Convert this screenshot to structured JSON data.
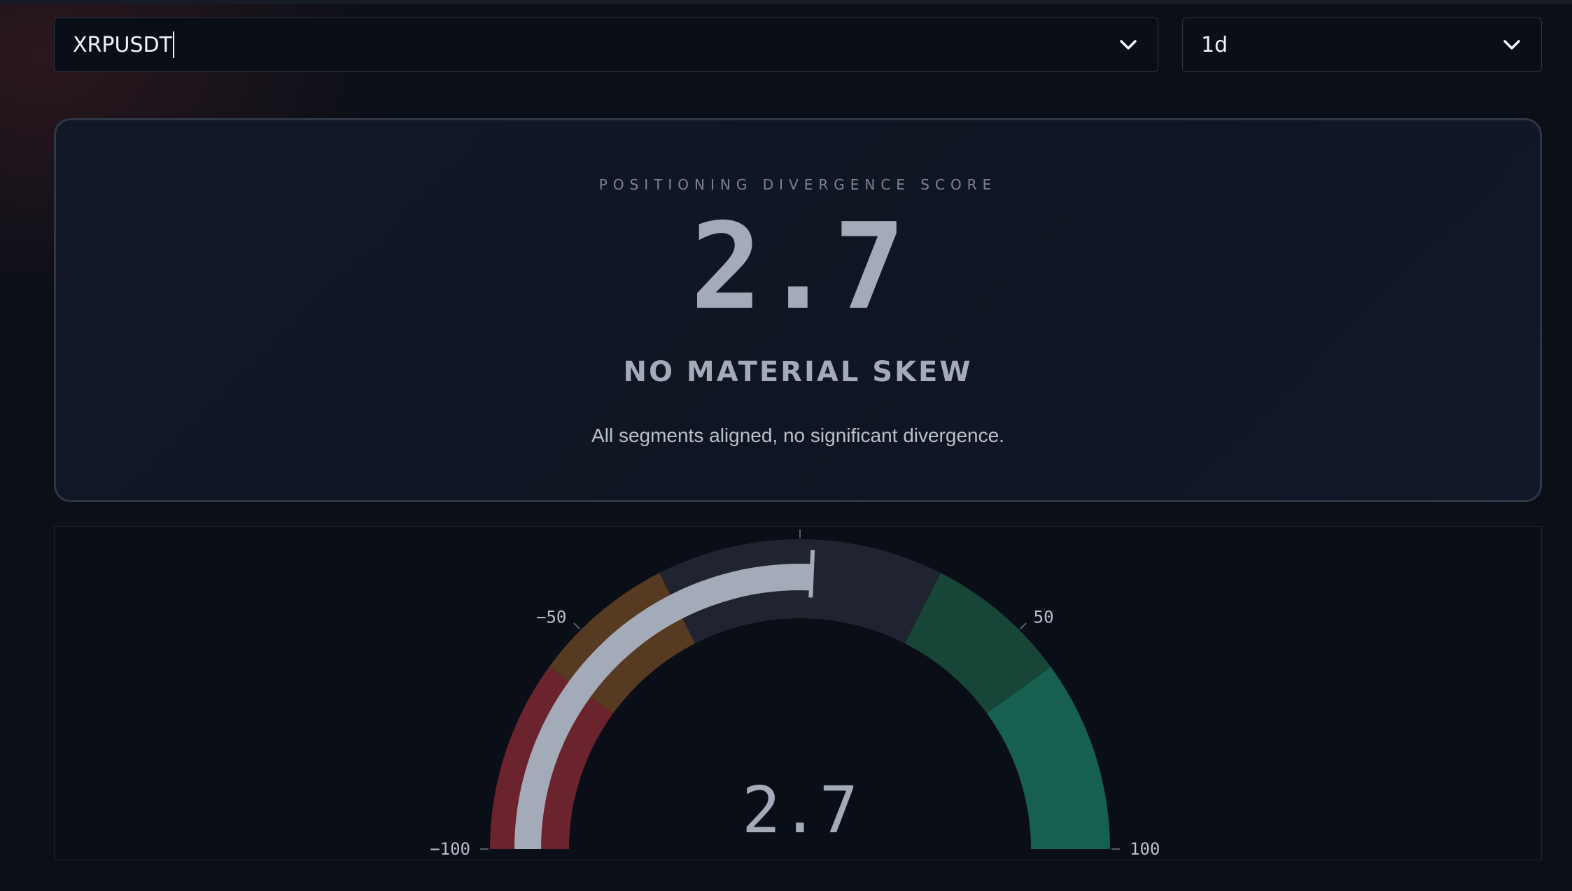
{
  "symbol_select": {
    "value": "XRPUSDT"
  },
  "interval_select": {
    "value": "1d"
  },
  "score_card": {
    "label": "POSITIONING DIVERGENCE SCORE",
    "value": "2.7",
    "verdict": "NO MATERIAL SKEW",
    "description": "All segments aligned, no significant divergence."
  },
  "gauge": {
    "value": 2.7,
    "value_text": "2.7",
    "min": -100,
    "max": 100,
    "ticks": [
      {
        "value": -100,
        "label": "−100"
      },
      {
        "value": -50,
        "label": "−50"
      },
      {
        "value": 0,
        "label": ""
      },
      {
        "value": 50,
        "label": "50"
      },
      {
        "value": 100,
        "label": "100"
      }
    ],
    "bands": [
      {
        "from": -100,
        "to": -60,
        "color": "#6b242d"
      },
      {
        "from": -60,
        "to": -30,
        "color": "#573a22"
      },
      {
        "from": 30,
        "to": 60,
        "color": "#174538"
      },
      {
        "from": 60,
        "to": 100,
        "color": "#17604f"
      }
    ],
    "neutral_band": {
      "from": -30,
      "to": 30,
      "color": "#1f2430"
    },
    "bar_color": "#a3aab8"
  },
  "icons": {
    "dropdown": "chevron-down-icon"
  }
}
